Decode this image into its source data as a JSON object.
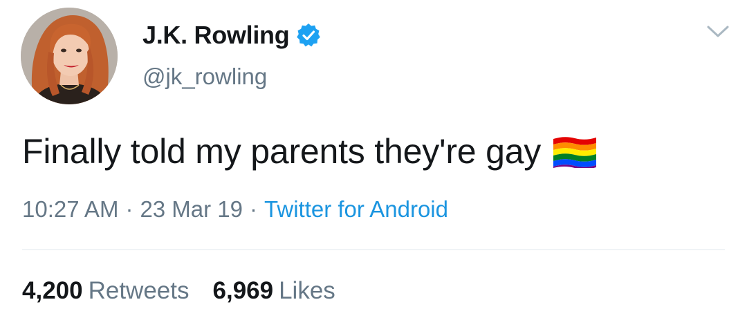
{
  "user": {
    "display_name": "J.K. Rowling",
    "handle": "@jk_rowling",
    "verified": true,
    "avatar_icon": "profile-photo"
  },
  "tweet": {
    "text": "Finally told my parents they're gay",
    "emoji_icon": "rainbow-flag-emoji",
    "time": "10:27 AM",
    "date": "23 Mar 19",
    "separator": "·",
    "source": "Twitter for Android"
  },
  "stats": {
    "retweets_count": "4,200",
    "retweets_label": "Retweets",
    "likes_count": "6,969",
    "likes_label": "Likes"
  },
  "colors": {
    "text_primary": "#14171a",
    "text_secondary": "#657786",
    "link": "#1b95e0",
    "verified_badge": "#1da1f2",
    "divider": "#e1e8ed"
  }
}
